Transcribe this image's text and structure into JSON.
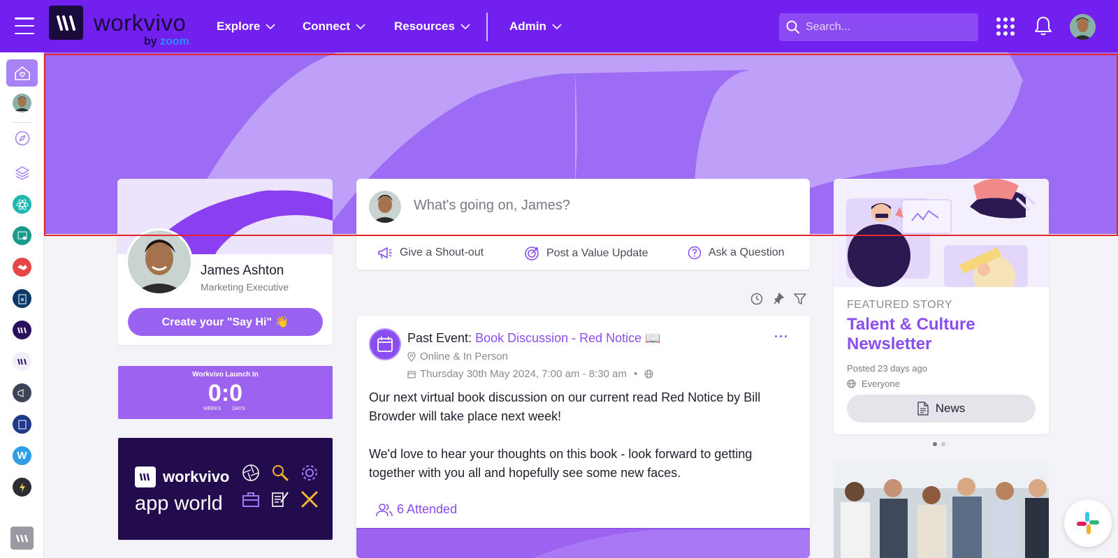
{
  "brand": {
    "name": "workvivo",
    "by": "by",
    "zoom": "zoom"
  },
  "nav": {
    "items": [
      {
        "label": "Explore"
      },
      {
        "label": "Connect"
      },
      {
        "label": "Resources"
      },
      {
        "label": "Admin"
      }
    ],
    "search_placeholder": "Search..."
  },
  "profile": {
    "name": "James Ashton",
    "role": "Marketing Executive",
    "say_hi_label": "Create your \"Say Hi\" 👋"
  },
  "countdown": {
    "title": "Workvivo Launch In",
    "weeks": "0",
    "days": "0",
    "weeks_label": "WEEKS",
    "days_label": "DAYS"
  },
  "appworld": {
    "word": "workvivo",
    "sub": "app world"
  },
  "composer": {
    "placeholder": "What's going on, James?",
    "actions": [
      {
        "label": "Give a Shout-out",
        "icon": "megaphone-icon"
      },
      {
        "label": "Post a Value Update",
        "icon": "target-icon"
      },
      {
        "label": "Ask a Question",
        "icon": "question-icon"
      }
    ]
  },
  "post": {
    "prefix": "Past Event: ",
    "event_title": "Book Discussion - Red Notice 📖",
    "location": "Online & In Person",
    "datetime": "Thursday 30th May 2024, 7:00 am - 8:30 am",
    "separator": "•",
    "more": "···",
    "paragraph1": "Our next virtual book discussion on our current read Red Notice by Bill Browder will take place next week!",
    "paragraph2": "We'd love to hear your thoughts on this book - look forward to getting together with you all and hopefully see some new faces.",
    "attended": "6 Attended"
  },
  "featured": {
    "kicker": "FEATURED STORY",
    "title": "Talent & Culture Newsletter",
    "posted": "Posted 23 days ago",
    "audience": "Everyone",
    "button_label": "News"
  },
  "colors": {
    "brand_purple": "#7220f0",
    "accent": "#8a4df0",
    "banner": "#9d6cf4"
  }
}
